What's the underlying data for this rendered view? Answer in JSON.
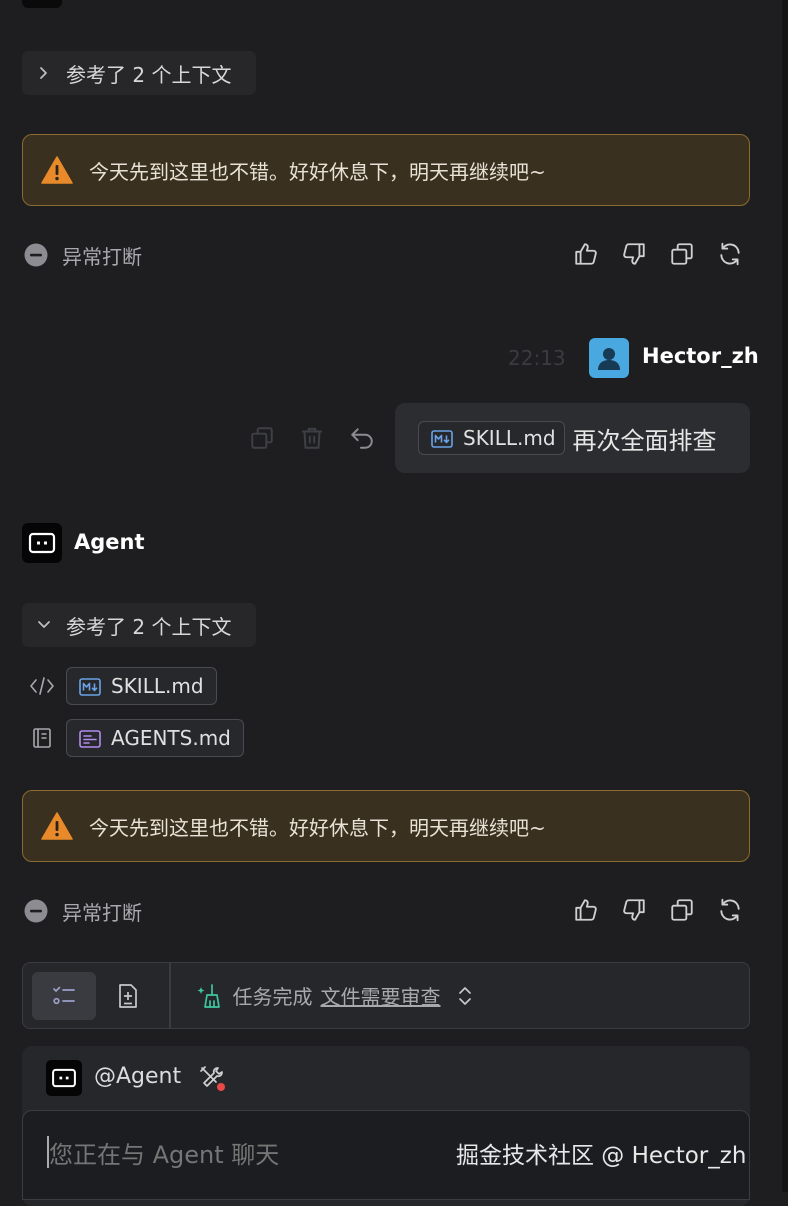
{
  "context_toggle_1": {
    "label": "参考了 2 个上下文",
    "state": "collapsed"
  },
  "warning_1": {
    "text": "今天先到这里也不错。好好休息下，明天再继续吧~"
  },
  "status_1": {
    "text": "异常打断"
  },
  "user_message": {
    "timestamp": "22:13",
    "user_name": "Hector_zh",
    "file_chip": "SKILL.md",
    "text": "再次全面排查"
  },
  "agent": {
    "name": "Agent"
  },
  "context_toggle_2": {
    "label": "参考了 2 个上下文",
    "state": "expanded"
  },
  "context_files": [
    {
      "name": "SKILL.md",
      "type": "markdown"
    },
    {
      "name": "AGENTS.md",
      "type": "agents"
    }
  ],
  "warning_2": {
    "text": "今天先到这里也不错。好好休息下，明天再继续吧~"
  },
  "status_2": {
    "text": "异常打断"
  },
  "task_bar": {
    "status_text": "任务完成",
    "review_link": "文件需要审查"
  },
  "composer": {
    "mention": "@Agent",
    "placeholder": "您正在与 Agent 聊天"
  },
  "watermark": "掘金技术社区 @ Hector_zh",
  "colors": {
    "background": "#1e1e20",
    "warning_bg": "#3a3020",
    "warning_border": "#8a6a30",
    "warning_icon": "#e88a2a",
    "user_avatar": "#4aa8e0",
    "success_icon": "#3cc7a0",
    "mention_dot": "#e84a4a"
  },
  "icons": {
    "chevron_right": "chevron-right-icon",
    "chevron_down": "chevron-down-icon",
    "warning": "warning-triangle-icon",
    "interrupt": "minus-circle-icon",
    "like": "thumbs-up-icon",
    "dislike": "thumbs-down-icon",
    "copy": "copy-icon",
    "regenerate": "refresh-icon",
    "delete": "trash-icon",
    "undo": "undo-icon",
    "code": "code-icon",
    "doc": "book-icon",
    "checklist": "checklist-icon",
    "add_file": "file-plus-icon",
    "clean": "broom-sparkle-icon",
    "updown": "chevron-updown-icon",
    "tools": "tools-icon"
  }
}
